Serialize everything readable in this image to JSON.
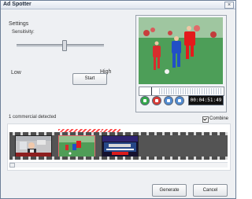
{
  "window": {
    "title": "Ad Spotter"
  },
  "settings": {
    "title": "Settings",
    "sensitivity_label": "Sensitivity:",
    "low_label": "Low",
    "high_label": "High",
    "start_label": "Start"
  },
  "player": {
    "time": "00:04:51:49"
  },
  "detection": {
    "summary": "1 commercial detected",
    "combine_label": "Combine",
    "combine_checked": true
  },
  "actions": {
    "generate_label": "Generate",
    "cancel_label": "Cancel"
  },
  "icons": {
    "close": "close-icon",
    "play": "play-icon",
    "stop": "stop-icon",
    "previous": "previous-icon",
    "next": "next-icon",
    "checkbox": "checkbox-icon"
  },
  "colors": {
    "play": "#34a84a",
    "stop": "#d63b35",
    "nav": "#4f8ad1",
    "marker": "#ff4a4a"
  }
}
